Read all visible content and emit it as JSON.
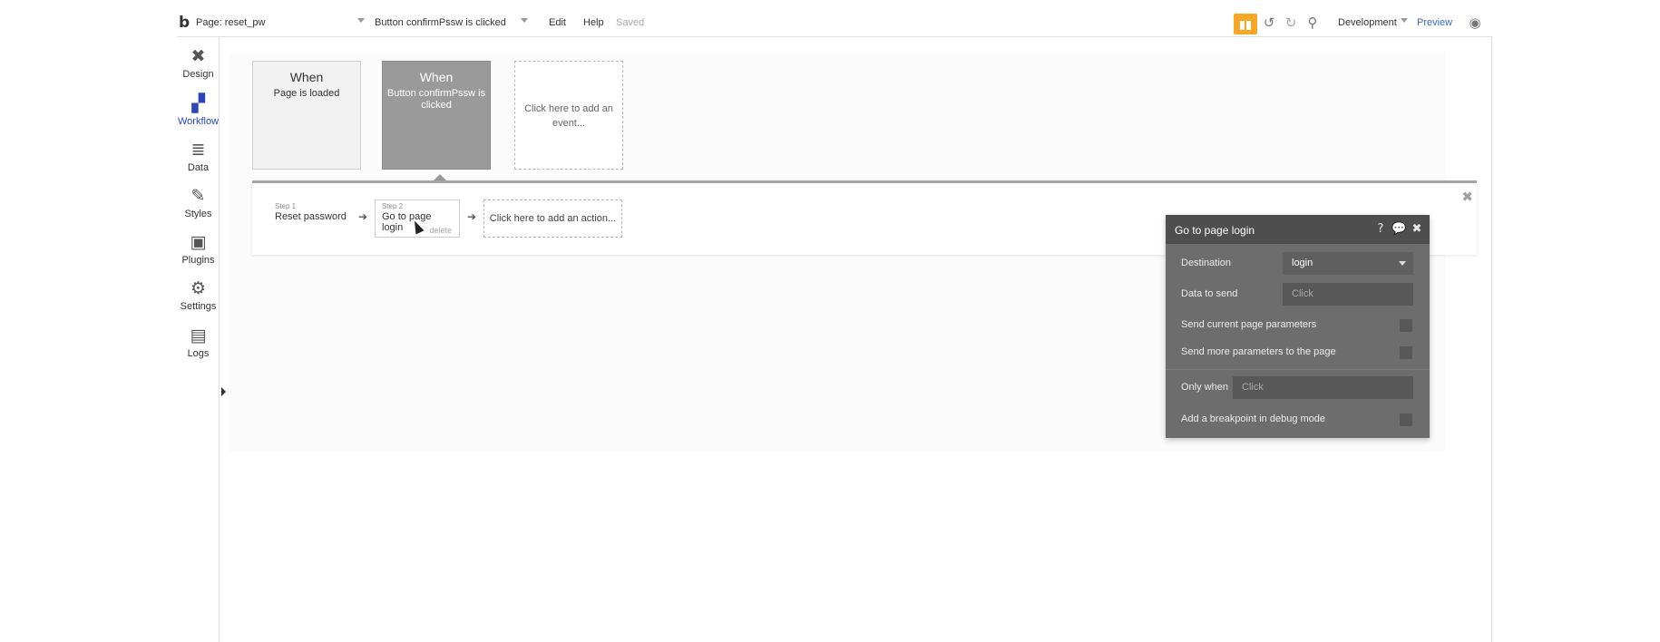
{
  "topbar": {
    "logo": "b",
    "page_label": "Page: reset_pw",
    "event_selector": "Button confirmPssw is clicked",
    "menu_edit": "Edit",
    "menu_help": "Help",
    "status": "Saved",
    "environment": "Development",
    "preview": "Preview",
    "icons": [
      "gift-icon",
      "undo-icon",
      "redo-icon",
      "search-icon",
      "user-icon"
    ]
  },
  "leftnav": {
    "items": [
      {
        "label": "Design",
        "icon": "design-icon"
      },
      {
        "label": "Workflow",
        "icon": "workflow-icon",
        "active": true
      },
      {
        "label": "Data",
        "icon": "database-icon"
      },
      {
        "label": "Styles",
        "icon": "brush-icon"
      },
      {
        "label": "Plugins",
        "icon": "plugin-icon"
      },
      {
        "label": "Settings",
        "icon": "gear-icon"
      },
      {
        "label": "Logs",
        "icon": "document-icon"
      }
    ]
  },
  "events": [
    {
      "when": "When",
      "desc": "Page is loaded"
    },
    {
      "when": "When",
      "desc": "Button confirmPssw is clicked",
      "selected": true
    },
    {
      "add_label": "Click here to add an event..."
    }
  ],
  "steps": [
    {
      "label": "Step 1",
      "name": "Reset password"
    },
    {
      "label": "Step 2",
      "name": "Go to page login",
      "delete": "delete"
    }
  ],
  "add_action": "Click here to add an action...",
  "panel": {
    "title": "Go to page login",
    "destination_label": "Destination",
    "destination_value": "login",
    "data_to_send_label": "Data to send",
    "data_to_send_placeholder": "Click",
    "send_current_params_label": "Send current page parameters",
    "send_current_params_checked": false,
    "send_more_params_label": "Send more parameters to the page",
    "send_more_params_checked": false,
    "only_when_label": "Only when",
    "only_when_placeholder": "Click",
    "breakpoint_label": "Add a breakpoint in debug mode",
    "breakpoint_checked": false
  },
  "colors": {
    "accent": "#2a46b8",
    "gift": "#f6a723",
    "panel_bg": "#6d6d6d",
    "panel_header": "#4e4e4e",
    "selected_event": "#9a9a9a"
  }
}
